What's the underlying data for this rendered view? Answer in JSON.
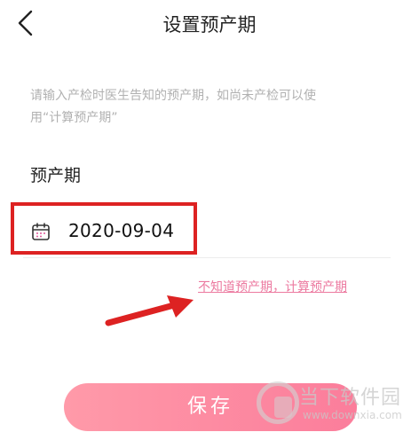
{
  "header": {
    "title": "设置预产期",
    "back_icon": "chevron-left-icon"
  },
  "hint": {
    "line1": "请输入产检时医生告知的预产期，如尚未产检可以使",
    "line2": "用“计算预产期”"
  },
  "form": {
    "label": "预产期",
    "date_value": "2020-09-04",
    "date_icon": "calendar-icon"
  },
  "calc_link": "不知道预产期，计算预产期",
  "save_label": "保存",
  "watermark": {
    "name": "当下软件园",
    "url": "www.downxia.com"
  },
  "colors": {
    "accent_pink": "#fb7d9b",
    "link_pink": "#ec7aa0",
    "annotation_red": "#dd2222",
    "hint_gray": "#b1b1b1"
  }
}
